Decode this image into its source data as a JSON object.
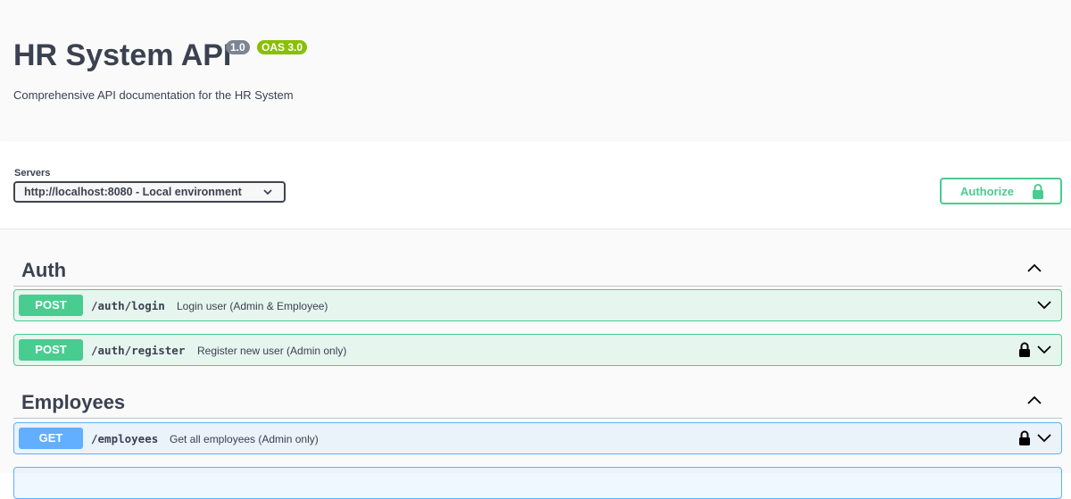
{
  "info": {
    "title": "HR System API",
    "version_badge": "1.0",
    "oas_badge": "OAS 3.0",
    "description": "Comprehensive API documentation for the HR System"
  },
  "servers": {
    "label": "Servers",
    "selected": "http://localhost:8080 - Local environment"
  },
  "authorize": {
    "label": "Authorize"
  },
  "tags": [
    {
      "name": "Auth",
      "operations": [
        {
          "method": "POST",
          "path": "/auth/login",
          "summary": "Login user (Admin & Employee)",
          "locked": false
        },
        {
          "method": "POST",
          "path": "/auth/register",
          "summary": "Register new user (Admin only)",
          "locked": true
        }
      ]
    },
    {
      "name": "Employees",
      "operations": [
        {
          "method": "GET",
          "path": "/employees",
          "summary": "Get all employees (Admin only)",
          "locked": true
        }
      ]
    }
  ],
  "colors": {
    "post": "#49cc90",
    "get": "#61affe",
    "text": "#3b4151"
  }
}
